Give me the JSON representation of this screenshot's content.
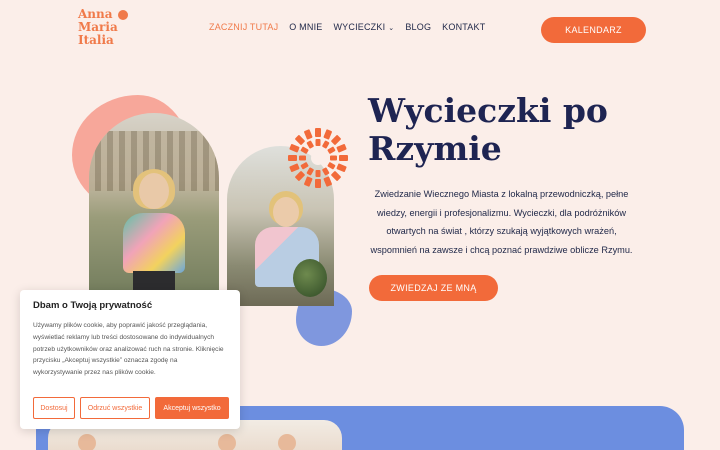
{
  "logo": {
    "line1": "Anna",
    "line2": "Maria",
    "line3": "Italia"
  },
  "nav": {
    "items": [
      {
        "label": "ZACZNIJ TUTAJ",
        "active": true
      },
      {
        "label": "O MNIE"
      },
      {
        "label": "WYCIECZKI",
        "has_dropdown": true
      },
      {
        "label": "BLOG"
      },
      {
        "label": "KONTAKT"
      }
    ],
    "chevron": "⌄"
  },
  "header": {
    "calendar_button": "KALENDARZ"
  },
  "hero": {
    "title": "Wycieczki po Rzymie",
    "text": "Zwiedzanie Wiecznego Miasta z lokalną przewodniczką, pełne wiedzy, energii i profesjonalizmu. Wycieczki, dla podróżników otwartych na świat , którzy szukają wyjątkowych wrażeń, wspomnień na zawsze i chcą poznać prawdziwe oblicze Rzymu.",
    "cta": "ZWIEDZAJ ZE MNĄ"
  },
  "cookie": {
    "title": "Dbam o Twoją prywatność",
    "body": "Używamy plików cookie, aby poprawić jakość przeglądania, wyświetlać reklamy lub treści dostosowane do indywidualnych potrzeb użytkowników oraz analizować ruch na stronie. Kliknięcie przycisku „Akceptuj wszystkie” oznacza zgodę na wykorzystywanie przez nas plików cookie.",
    "customize": "Dostosuj",
    "reject": "Odrzuć wszystkie",
    "accept": "Akceptuj wszystko"
  },
  "colors": {
    "accent": "#f26a3a",
    "navy": "#1e2452",
    "background": "#fbeee9",
    "blue": "#6c8ee0",
    "pink": "#f7a79a"
  }
}
